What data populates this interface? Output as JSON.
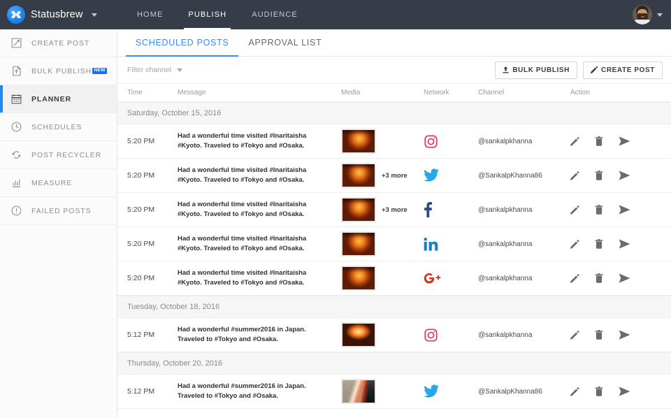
{
  "header": {
    "brand": "Statusbrew",
    "brand_caret_icon": "chevron-down-icon",
    "logo_icon": "statusbrew-logo-icon",
    "nav": [
      {
        "label": "HOME",
        "active": false
      },
      {
        "label": "PUBLISH",
        "active": true
      },
      {
        "label": "AUDIENCE",
        "active": false
      }
    ],
    "avatar_icon": "user-avatar",
    "avatar_caret_icon": "chevron-down-icon"
  },
  "sidebar": {
    "items": [
      {
        "label": "CREATE POST",
        "icon": "compose-icon",
        "active": false,
        "badge": ""
      },
      {
        "label": "BULK PUBLISH",
        "icon": "upload-file-icon",
        "active": false,
        "badge": "NEW"
      },
      {
        "label": "PLANNER",
        "icon": "calendar-icon",
        "active": true,
        "badge": ""
      },
      {
        "label": "SCHEDULES",
        "icon": "clock-icon",
        "active": false,
        "badge": ""
      },
      {
        "label": "POST RECYCLER",
        "icon": "recycle-icon",
        "active": false,
        "badge": ""
      },
      {
        "label": "MEASURE",
        "icon": "bar-chart-icon",
        "active": false,
        "badge": ""
      },
      {
        "label": "FAILED POSTS",
        "icon": "alert-circle-icon",
        "active": false,
        "badge": ""
      }
    ]
  },
  "main": {
    "tabs": [
      {
        "label": "SCHEDULED POSTS",
        "active": true
      },
      {
        "label": "APPROVAL LIST",
        "active": false
      }
    ],
    "toolbar": {
      "filter_label": "Filter channel",
      "filter_caret_icon": "chevron-down-icon",
      "bulk_publish_label": "BULK PUBLISH",
      "bulk_publish_icon": "upload-icon",
      "create_post_label": "CREATE POST",
      "create_post_icon": "pencil-icon"
    },
    "table": {
      "columns": [
        "Time",
        "Message",
        "Media",
        "Network",
        "Channel",
        "Action"
      ],
      "groups": [
        {
          "date": "Saturday, October 15, 2016",
          "rows": [
            {
              "time": "5:20 PM",
              "message": "Had a wonderful time visited #Inaritaisha #Kyoto. Traveled to #Tokyo and #Osaka.",
              "thumb": "torii",
              "more": "",
              "network": "instagram",
              "channel": "@sankalpkhanna"
            },
            {
              "time": "5:20 PM",
              "message": "Had a wonderful time visited #Inaritaisha #Kyoto. Traveled to #Tokyo and #Osaka.",
              "thumb": "torii",
              "more": "+3 more",
              "network": "twitter",
              "channel": "@SankalpKhanna86"
            },
            {
              "time": "5:20 PM",
              "message": "Had a wonderful time visited #Inaritaisha #Kyoto. Traveled to #Tokyo and #Osaka.",
              "thumb": "torii",
              "more": "+3 more",
              "network": "facebook",
              "channel": "@sankalpkhanna"
            },
            {
              "time": "5:20 PM",
              "message": "Had a wonderful time visited #Inaritaisha #Kyoto. Traveled to #Tokyo and #Osaka.",
              "thumb": "torii",
              "more": "",
              "network": "linkedin",
              "channel": "@sankalpkhanna"
            },
            {
              "time": "5:20 PM",
              "message": "Had a wonderful time visited #Inaritaisha #Kyoto. Traveled to #Tokyo and #Osaka.",
              "thumb": "torii",
              "more": "",
              "network": "googleplus",
              "channel": "@sankalpkhanna"
            }
          ]
        },
        {
          "date": "Tuesday, October 18, 2016",
          "rows": [
            {
              "time": "5:12 PM",
              "message": "Had a wonderful #summer2016 in Japan. Traveled to #Tokyo and #Osaka.",
              "thumb": "fire",
              "more": "",
              "network": "instagram",
              "channel": "@sankalpkhanna"
            }
          ]
        },
        {
          "date": "Thursday, October 20, 2016",
          "rows": [
            {
              "time": "5:12 PM",
              "message": "Had a wonderful #summer2016 in Japan. Traveled to #Tokyo and #Osaka.",
              "thumb": "lights",
              "more": "",
              "network": "twitter",
              "channel": "@SankalpKhanna86"
            }
          ]
        }
      ],
      "row_actions": [
        {
          "icon": "pencil-icon",
          "name": "edit-post-button"
        },
        {
          "icon": "trash-icon",
          "name": "delete-post-button"
        },
        {
          "icon": "send-icon",
          "name": "publish-now-button"
        }
      ]
    }
  },
  "colors": {
    "topbar": "#373d48",
    "accent": "#4285f4",
    "active_bar": "#1a8cf0",
    "instagram": "#e1306c",
    "twitter": "#26a7ec",
    "facebook": "#2b4a8b",
    "linkedin": "#1683bf",
    "googleplus": "#d3321f",
    "badge_new": "#1a73e8"
  }
}
